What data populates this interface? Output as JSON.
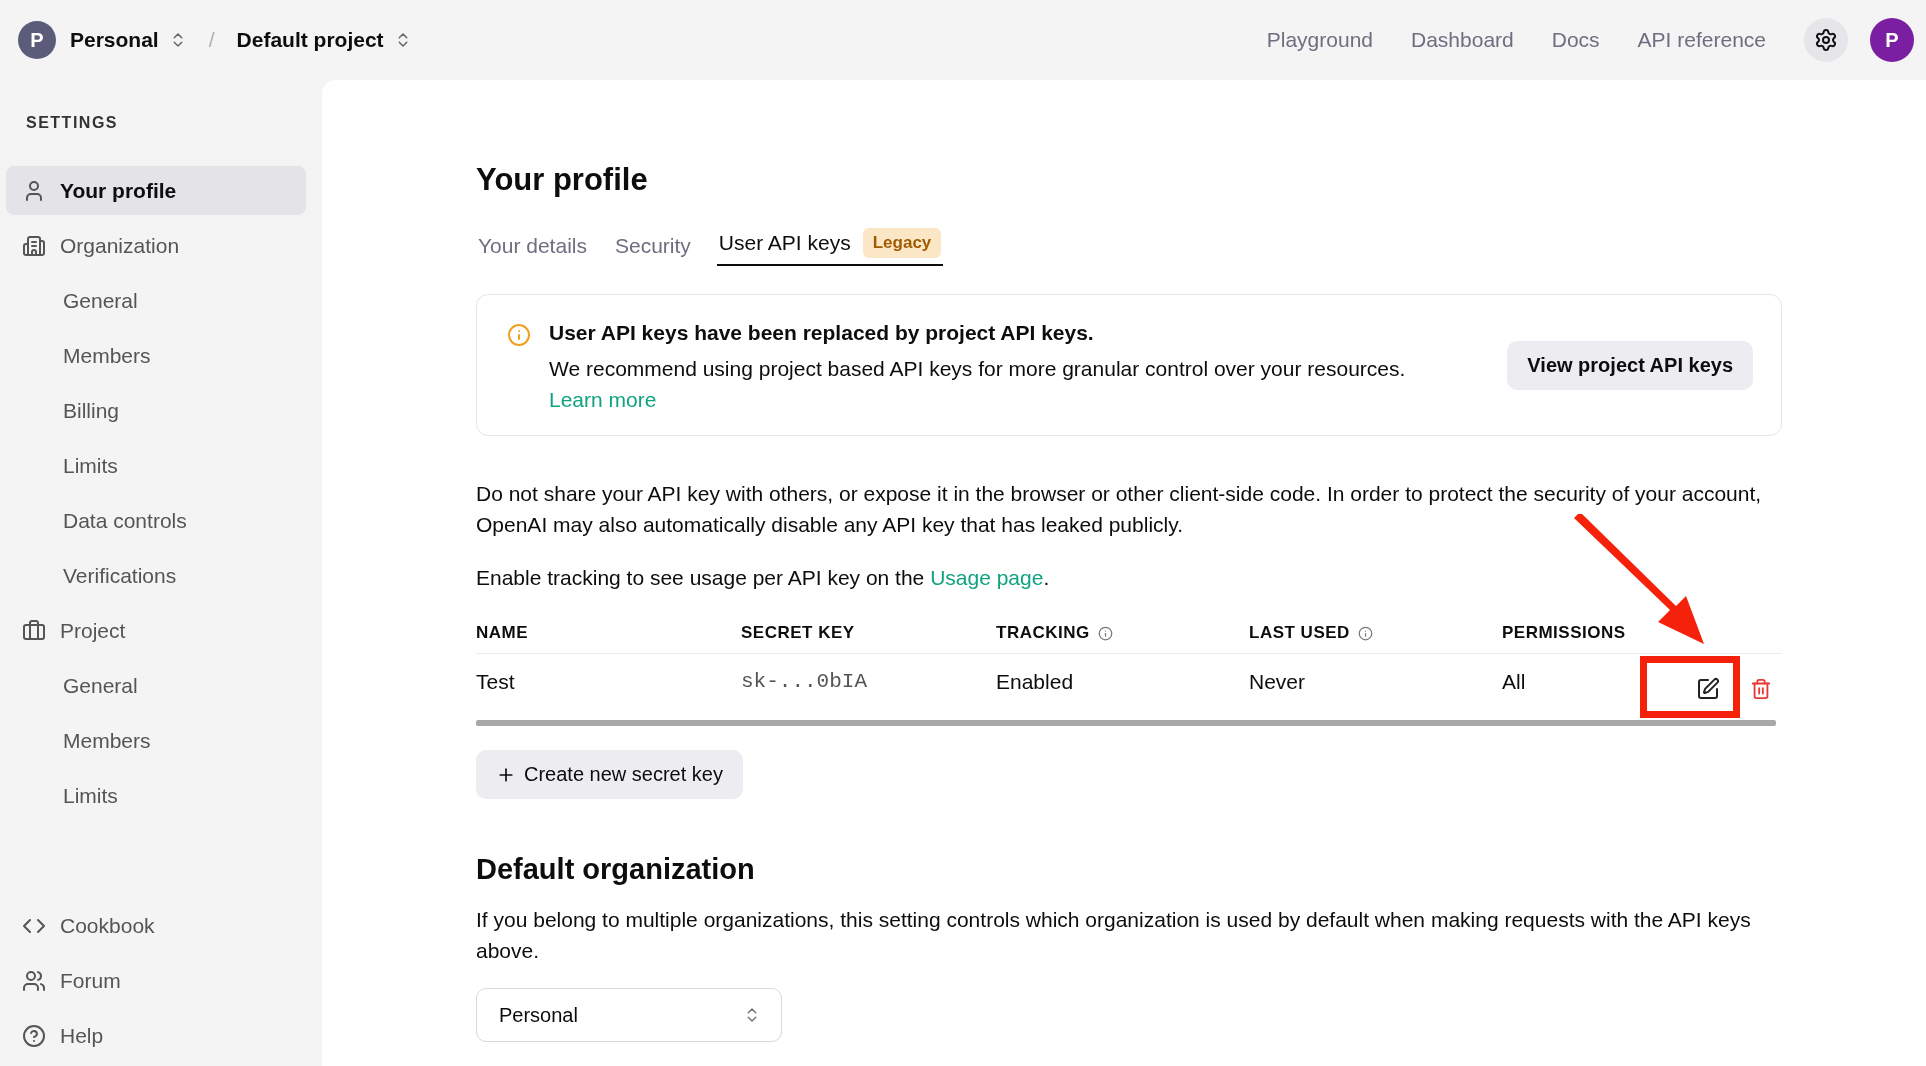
{
  "topbar": {
    "org": {
      "avatar": "P",
      "name": "Personal"
    },
    "separator": "/",
    "project": "Default project",
    "links": [
      {
        "label": "Playground"
      },
      {
        "label": "Dashboard"
      },
      {
        "label": "Docs"
      },
      {
        "label": "API reference"
      }
    ],
    "user_avatar": "P"
  },
  "sidebar": {
    "heading": "SETTINGS",
    "items": [
      {
        "kind": "section",
        "label": "Your profile",
        "selected": true
      },
      {
        "kind": "section",
        "label": "Organization",
        "selected": false
      },
      {
        "kind": "sub",
        "label": "General",
        "selected": false
      },
      {
        "kind": "sub",
        "label": "Members",
        "selected": false
      },
      {
        "kind": "sub",
        "label": "Billing",
        "selected": false
      },
      {
        "kind": "sub",
        "label": "Limits",
        "selected": false
      },
      {
        "kind": "sub",
        "label": "Data controls",
        "selected": false
      },
      {
        "kind": "sub",
        "label": "Verifications",
        "selected": false
      },
      {
        "kind": "section",
        "label": "Project",
        "selected": false
      },
      {
        "kind": "sub",
        "label": "General",
        "selected": false
      },
      {
        "kind": "sub",
        "label": "Members",
        "selected": false
      },
      {
        "kind": "sub",
        "label": "Limits",
        "selected": false
      }
    ],
    "footer_links": [
      {
        "label": "Cookbook"
      },
      {
        "label": "Forum"
      },
      {
        "label": "Help"
      }
    ]
  },
  "main": {
    "title": "Your profile",
    "tabs": [
      {
        "label": "Your details",
        "selected": false
      },
      {
        "label": "Security",
        "selected": false
      },
      {
        "label": "User API keys",
        "selected": true,
        "badge": "Legacy"
      }
    ],
    "notice": {
      "title": "User API keys have been replaced by project API keys.",
      "body": "We recommend using project based API keys for more granular control over your resources.",
      "link": "Learn more",
      "button": "View project API keys"
    },
    "warning": "Do not share your API key with others, or expose it in the browser or other client-side code. In order to protect the security of your account, OpenAI may also automatically disable any API key that has leaked publicly.",
    "tracking_text": "Enable tracking to see usage per API key on the",
    "tracking_link": "Usage page",
    "tracking_end": ".",
    "table": {
      "columns": [
        {
          "label": "NAME",
          "info": false
        },
        {
          "label": "SECRET KEY",
          "info": false
        },
        {
          "label": "TRACKING",
          "info": true
        },
        {
          "label": "LAST USED",
          "info": true
        },
        {
          "label": "PERMISSIONS",
          "info": false
        }
      ],
      "rows": [
        {
          "cells": [
            "Test",
            "sk-...0bIA",
            "Enabled",
            "Never",
            "All"
          ]
        }
      ]
    },
    "create_button": "Create new secret key",
    "default_org": {
      "title": "Default organization",
      "text": "If you belong to multiple organizations, this setting controls which organization is used by default when making requests with the API keys above.",
      "select": "Personal"
    }
  }
}
